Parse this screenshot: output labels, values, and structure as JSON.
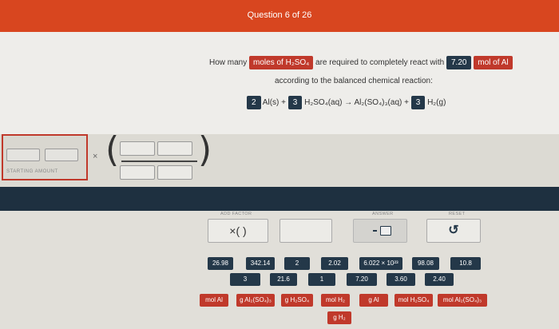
{
  "header": {
    "progress": "Question 6 of 26"
  },
  "question": {
    "prefix": "How many",
    "target_unit": "moles of H₂SO₄",
    "middle": "are required to completely react with",
    "given_value": "7.20",
    "given_unit": "mol of Al",
    "line2": "according to the balanced chemical reaction:",
    "equation": {
      "coef1": "2",
      "species1": "Al(s) +",
      "coef2": "3",
      "species2": "H₂SO₄(aq) → Al₂(SO₄)₃(aq) +",
      "coef3": "3",
      "species3": "H₂(g)"
    }
  },
  "workspace": {
    "starting_amount_label": "STARTING AMOUNT",
    "times": "×"
  },
  "controls": {
    "add_factor_label": "ADD FACTOR",
    "add_factor_text": "×( )",
    "answer_label": "ANSWER",
    "reset_label": "RESET",
    "reset_icon": "↺"
  },
  "tiles": {
    "numbers": [
      "26.98",
      "342.14",
      "2",
      "2.02",
      "6.022 × 10²³",
      "98.08",
      "10.8",
      "3",
      "21.6",
      "1",
      "7.20",
      "3.60",
      "2.40"
    ],
    "units": [
      "mol Al",
      "g Al₂(SO₄)₃",
      "g H₂SO₄",
      "mol H₂",
      "g Al",
      "mol H₂SO₄",
      "mol Al₂(SO₄)₃",
      "g H₂"
    ]
  },
  "colors": {
    "header": "#d8461f",
    "accent_red": "#c0392b",
    "navy": "#243849"
  }
}
